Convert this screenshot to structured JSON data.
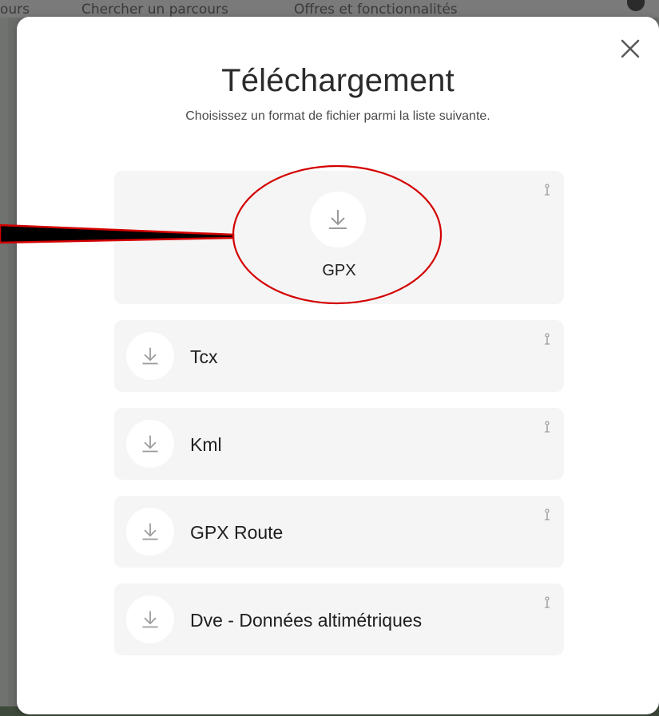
{
  "background": {
    "nav_items": [
      "ours",
      "Chercher un parcours",
      "Offres et fonctionnalités"
    ]
  },
  "modal": {
    "title": "Téléchargement",
    "subtitle": "Choisissez un format de fichier parmi la liste suivante.",
    "close_icon": "close-icon",
    "formats": [
      {
        "label": "GPX",
        "icon": "download-icon",
        "featured": true
      },
      {
        "label": "Tcx",
        "icon": "download-icon",
        "featured": false
      },
      {
        "label": "Kml",
        "icon": "download-icon",
        "featured": false
      },
      {
        "label": "GPX Route",
        "icon": "download-icon",
        "featured": false
      },
      {
        "label": "Dve - Données altimétriques",
        "icon": "download-icon",
        "featured": false
      }
    ]
  },
  "colors": {
    "annotation": "#d40000",
    "card_bg": "#f5f5f5",
    "icon_gray": "#9a9a9a"
  }
}
